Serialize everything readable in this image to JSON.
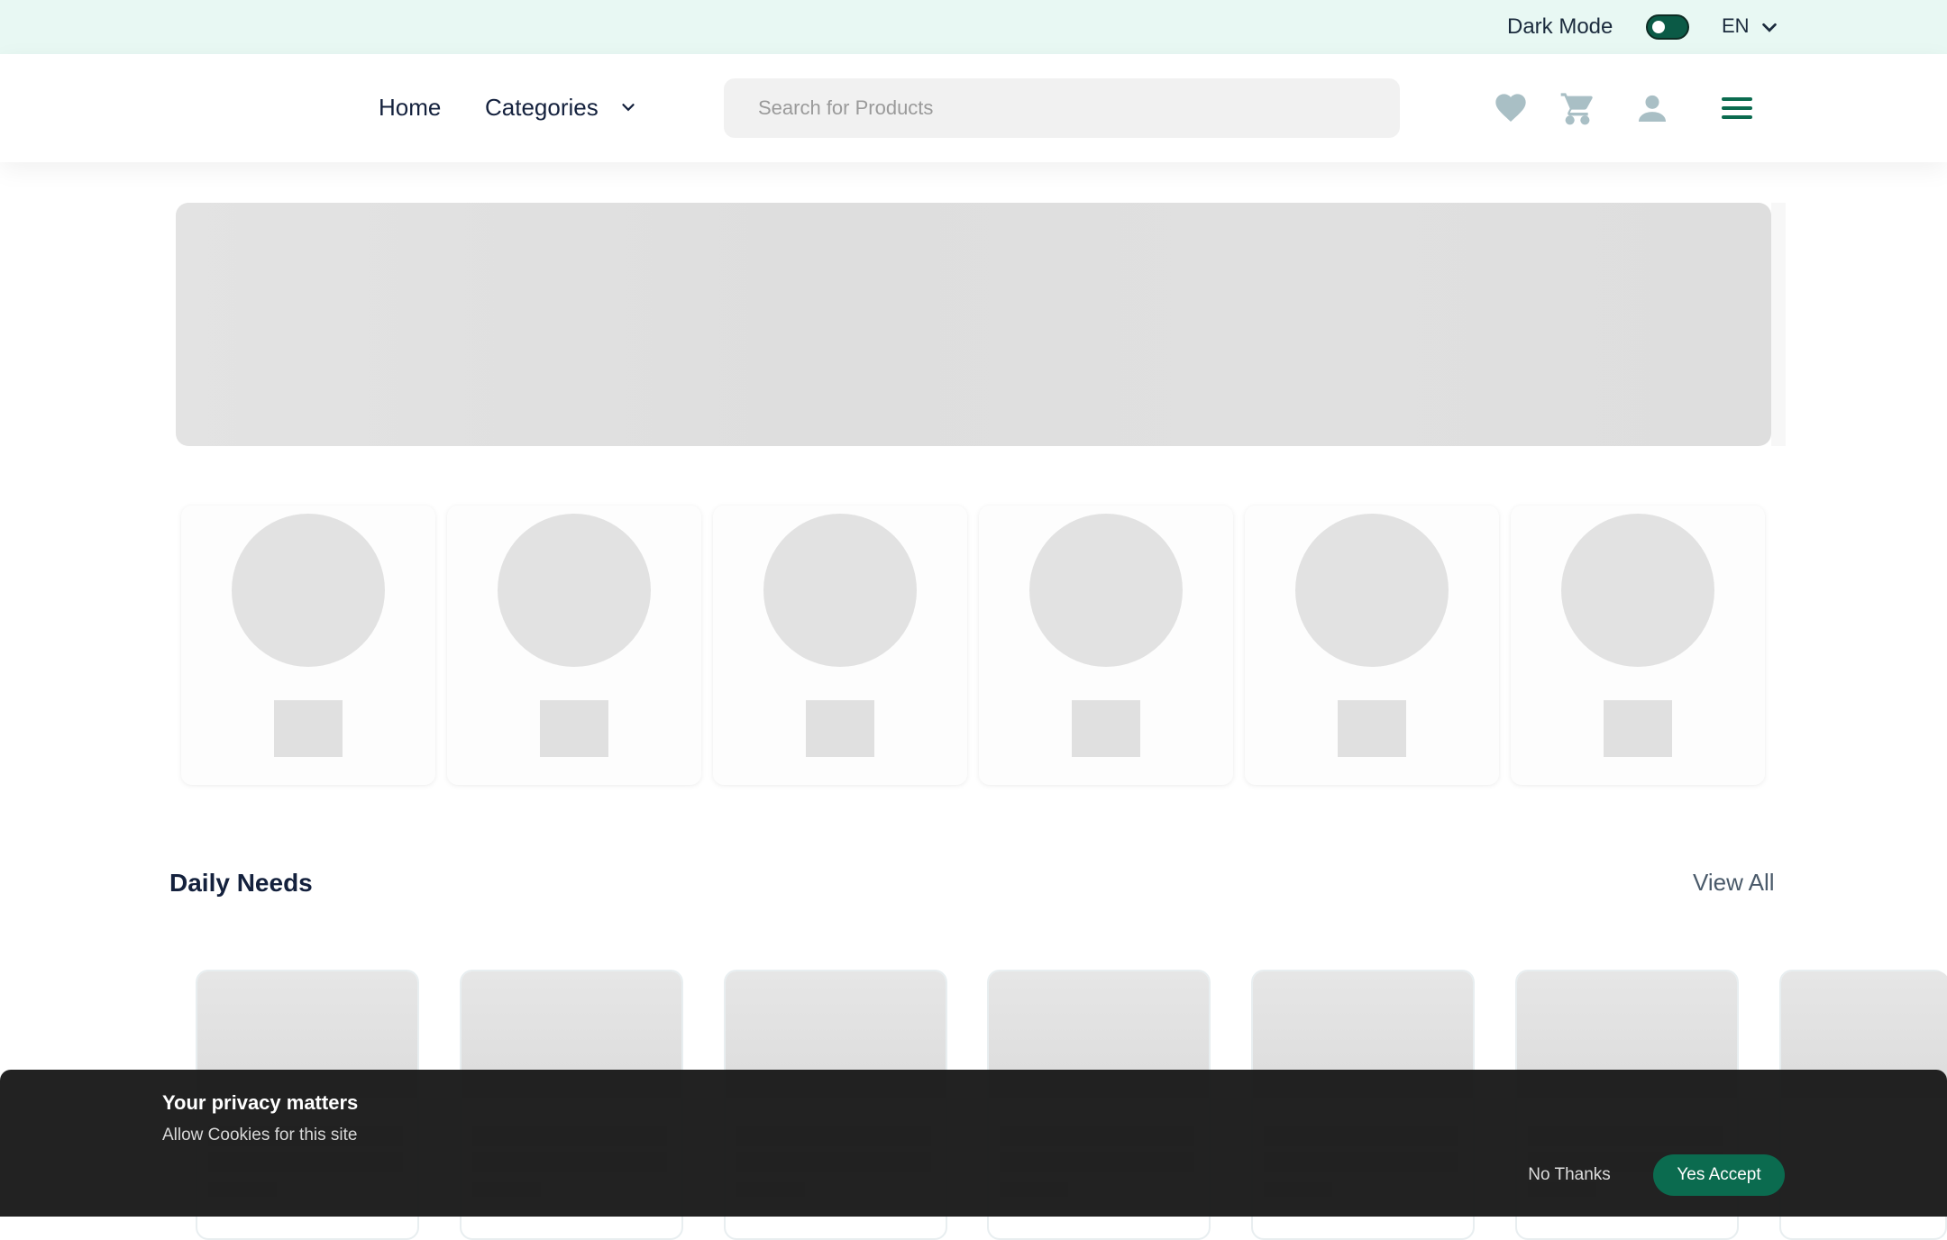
{
  "topbar": {
    "dark_mode_label": "Dark Mode",
    "dark_mode_on": true,
    "language": "EN"
  },
  "nav": {
    "home": "Home",
    "categories": "Categories",
    "search_placeholder": "Search for Products",
    "icons": [
      "heart-icon",
      "cart-icon",
      "user-icon",
      "menu-icon"
    ]
  },
  "section": {
    "title": "Daily Needs",
    "view_all": "View All"
  },
  "cookie": {
    "title": "Your privacy matters",
    "subtitle": "Allow Cookies for this site",
    "no_label": "No Thanks",
    "yes_label": "Yes Accept"
  },
  "colors": {
    "accent": "#0b6b4f",
    "topbar_bg": "#e8f8f3",
    "icon_muted": "#a9bfc5"
  }
}
